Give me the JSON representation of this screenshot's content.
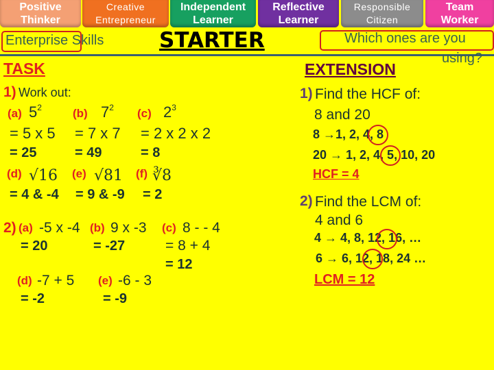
{
  "header_tabs": [
    {
      "label1": "Positive",
      "label2": "Thinker",
      "color": "#F4A074"
    },
    {
      "label1": "Creative",
      "label2": "Entrepreneur",
      "color": "#F07020"
    },
    {
      "label1": "Independent",
      "label2": "Learner",
      "color": "#17A060"
    },
    {
      "label1": "Reflective",
      "label2": "Learner",
      "color": "#7030A0"
    },
    {
      "label1": "Responsible",
      "label2": "Citizen",
      "color": "#8C8C8C"
    },
    {
      "label1": "Team",
      "label2": "Worker",
      "color": "#F040A0"
    }
  ],
  "enterprise_skills": "Enterprise Skills",
  "starter": "STARTER",
  "question": "Which ones are you",
  "question2": "using?",
  "task": "TASK",
  "extension": "EXTENSION",
  "q1": {
    "num": "1)",
    "title": "Work out:",
    "a": {
      "label": "(a)",
      "base": "5",
      "exp": "2",
      "step": "= 5 x 5",
      "answer": "= 25"
    },
    "b": {
      "label": "(b)",
      "base": "7",
      "exp": "2",
      "step": "= 7 x 7",
      "answer": "= 49"
    },
    "c": {
      "label": "(c)",
      "base": "2",
      "exp": "3",
      "step": "= 2 x 2 x 2",
      "answer": "= 8"
    },
    "d": {
      "label": "(d)",
      "expr": "√16",
      "answer": "= 4 & -4"
    },
    "e": {
      "label": "(e)",
      "expr": "√81",
      "answer": "= 9 & -9"
    },
    "f": {
      "label": "(f)",
      "expr": "∛8",
      "answer": "= 2"
    }
  },
  "q2": {
    "num": "2)",
    "a": {
      "label": "(a)",
      "expr": "-5 x -4",
      "answer": "= 20"
    },
    "b": {
      "label": "(b)",
      "expr": "9 x -3",
      "answer": "= -27"
    },
    "c": {
      "label": "(c)",
      "expr": "8 - - 4",
      "step": "= 8 + 4",
      "answer": "= 12"
    },
    "d": {
      "label": "(d)",
      "expr": "-7 + 5",
      "answer": "= -2"
    },
    "e": {
      "label": "(e)",
      "expr": "-6 - 3",
      "answer": "= -9"
    }
  },
  "ext1": {
    "num": "1)",
    "title": "Find the HCF of:",
    "numbers": "8 and 20",
    "line1": "8 →1, 2, 4, 8",
    "line2": "20 → 1, 2, 4, 5, 10, 20",
    "answer": "HCF = 4"
  },
  "ext2": {
    "num": "2)",
    "title": "Find the LCM of:",
    "numbers": "4 and 6",
    "line1": "4 → 4, 8, 12, 16, …",
    "line2": "6 → 6, 12, 18, 24 …",
    "answer": "LCM = 12"
  },
  "colors": {
    "background": "#FFFF00",
    "label_red": "#E02020",
    "extension": "#600040",
    "divider": "#3A6070"
  }
}
